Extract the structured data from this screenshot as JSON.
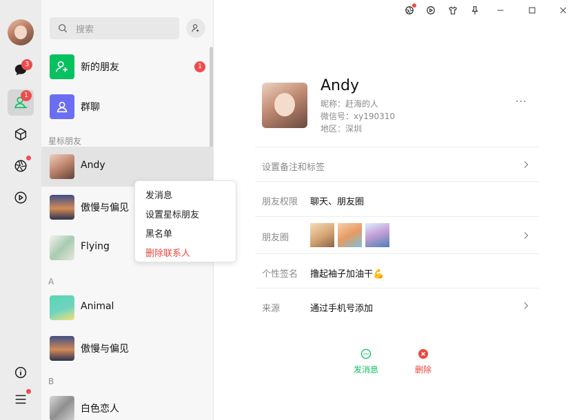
{
  "sidebar": {
    "chat_badge": "3",
    "contacts_badge": "1"
  },
  "search": {
    "placeholder": "搜索"
  },
  "list": {
    "new_friends": {
      "label": "新的朋友",
      "badge": "1"
    },
    "group_chat": {
      "label": "群聊"
    },
    "section_starred": "星标朋友",
    "section_a": "A",
    "section_b": "B",
    "contacts": [
      {
        "name": "Andy"
      },
      {
        "name": "傲慢与偏见"
      },
      {
        "name": "Flying"
      },
      {
        "name": "Animal"
      },
      {
        "name": "傲慢与偏见"
      },
      {
        "name": "白色恋人"
      }
    ]
  },
  "context_menu": {
    "items": [
      "发消息",
      "设置星标朋友",
      "黑名单",
      "删除联系人"
    ]
  },
  "profile": {
    "name": "Andy",
    "nickname": "昵称：赶海的人",
    "wechat_id": "微信号：xy190310",
    "region": "地区：深圳",
    "more": "···",
    "remark_row": "设置备注和标签",
    "permission_label": "朋友权限",
    "permission_value": "聊天、朋友圈",
    "moments_label": "朋友圈",
    "signature_label": "个性签名",
    "signature_value": "撸起袖子加油干💪",
    "source_label": "来源",
    "source_value": "通过手机号添加",
    "send_message": "发消息",
    "delete": "删除"
  },
  "colors": {
    "brand_green": "#07c160",
    "danger_red": "#e8473f",
    "badge_red": "#f04b4b",
    "group_purple": "#6b6ef0"
  }
}
